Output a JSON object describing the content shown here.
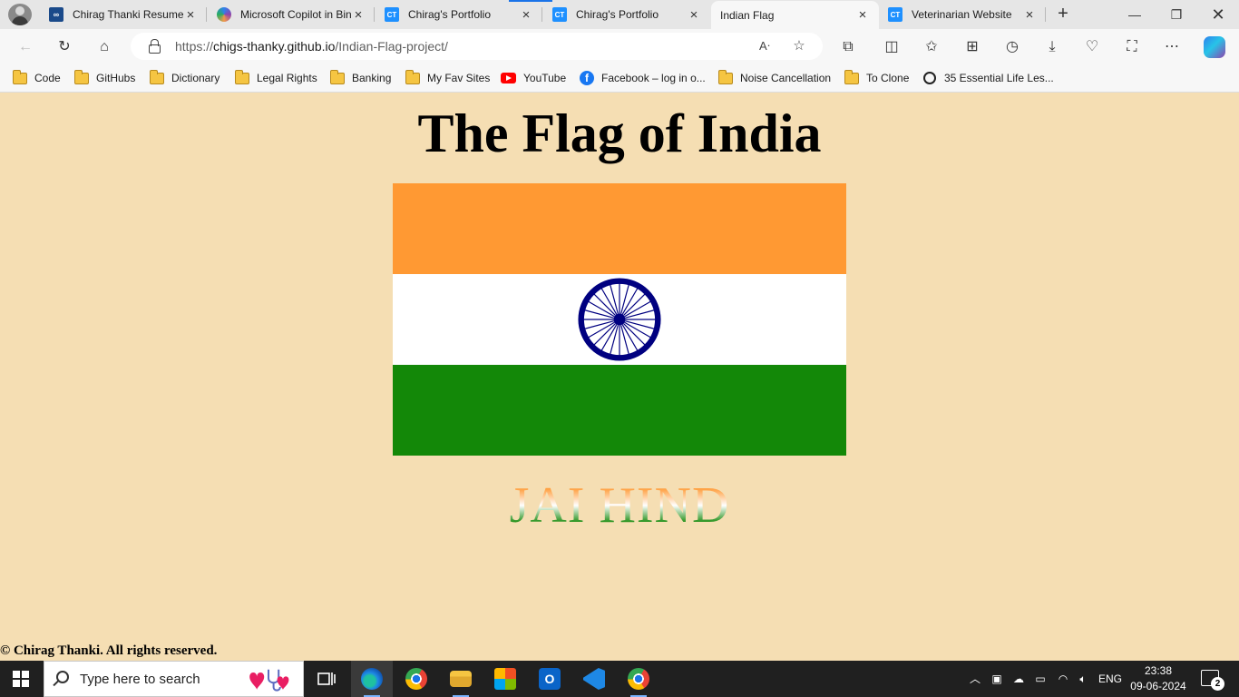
{
  "browser": {
    "tabs": [
      {
        "title": "Chirag Thanki Resume",
        "favicon": "infinity-icon",
        "active": false
      },
      {
        "title": "Microsoft Copilot in Bing",
        "favicon": "copilot-icon",
        "active": false
      },
      {
        "title": "Chirag's Portfolio",
        "favicon": "ct-icon",
        "favicon_text": "CT",
        "active": false
      },
      {
        "title": "Chirag's Portfolio",
        "favicon": "ct-icon",
        "favicon_text": "CT",
        "active": false
      },
      {
        "title": "Indian Flag",
        "favicon": "page-icon",
        "active": true
      },
      {
        "title": "Veterinarian Website",
        "favicon": "ct-icon",
        "favicon_text": "CT",
        "active": false
      }
    ],
    "address": {
      "scheme": "https://",
      "host": "chigs-thanky.github.io",
      "path": "/Indian-Flag-project/"
    },
    "bookmarks": [
      {
        "label": "Code",
        "icon": "folder-icon"
      },
      {
        "label": "GitHubs",
        "icon": "folder-icon"
      },
      {
        "label": "Dictionary",
        "icon": "folder-icon"
      },
      {
        "label": "Legal Rights",
        "icon": "folder-icon"
      },
      {
        "label": "Banking",
        "icon": "folder-icon"
      },
      {
        "label": "My Fav Sites",
        "icon": "folder-icon"
      },
      {
        "label": "YouTube",
        "icon": "youtube-icon"
      },
      {
        "label": "Facebook – log in o...",
        "icon": "facebook-icon"
      },
      {
        "label": "Noise Cancellation",
        "icon": "folder-icon"
      },
      {
        "label": "To Clone",
        "icon": "folder-icon"
      },
      {
        "label": "35 Essential Life Les...",
        "icon": "circle-icon"
      }
    ]
  },
  "page": {
    "title": "The Flag of India",
    "motto": "JAI HIND",
    "footer": "© Chirag Thanki. All rights reserved.",
    "flag_colors": {
      "saffron": "#ff9933",
      "white": "#ffffff",
      "green": "#138808",
      "chakra": "#000080"
    },
    "background": "#f5deb3"
  },
  "taskbar": {
    "search_placeholder": "Type here to search",
    "language": "ENG",
    "time": "23:38",
    "date": "09-06-2024",
    "notification_count": "2"
  }
}
